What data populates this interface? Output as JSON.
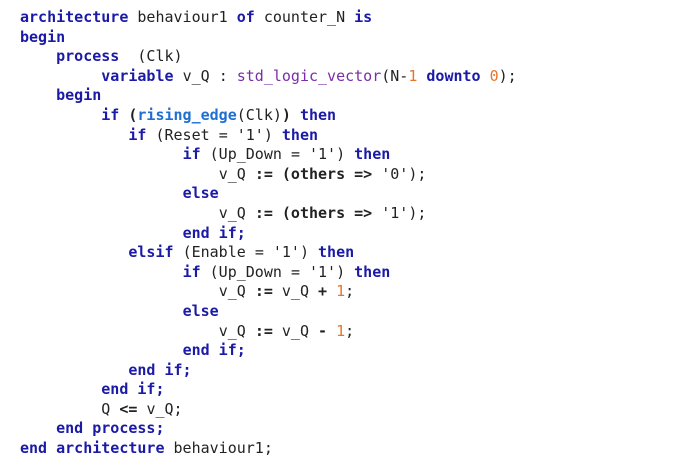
{
  "code": {
    "colors": {
      "keyword": "#1a1aa6",
      "type": "#7a2da8",
      "function": "#1f6fd1",
      "number": "#e8742a",
      "text": "#222222"
    },
    "lines": [
      [
        [
          "kw",
          "architecture"
        ],
        [
          "sp",
          " "
        ],
        [
          "id",
          "behaviour1"
        ],
        [
          "sp",
          " "
        ],
        [
          "kw",
          "of"
        ],
        [
          "sp",
          " "
        ],
        [
          "id",
          "counter_N"
        ],
        [
          "sp",
          " "
        ],
        [
          "kw",
          "is"
        ]
      ],
      [
        [
          "kw",
          "begin"
        ]
      ],
      [
        [
          "sp",
          "    "
        ],
        [
          "kw",
          "process"
        ],
        [
          "sp",
          "  "
        ],
        [
          "id",
          "(Clk)"
        ]
      ],
      [
        [
          "sp",
          "         "
        ],
        [
          "kw",
          "variable"
        ],
        [
          "sp",
          " "
        ],
        [
          "id",
          "v_Q"
        ],
        [
          "sp",
          " "
        ],
        [
          "id",
          ":"
        ],
        [
          "sp",
          " "
        ],
        [
          "type",
          "std_logic_vector"
        ],
        [
          "id",
          "(N-"
        ],
        [
          "num",
          "1"
        ],
        [
          "sp",
          " "
        ],
        [
          "kw",
          "downto"
        ],
        [
          "sp",
          " "
        ],
        [
          "num",
          "0"
        ],
        [
          "id",
          ");"
        ]
      ],
      [
        [
          "sp",
          "    "
        ],
        [
          "kw",
          "begin"
        ]
      ],
      [
        [
          "sp",
          "         "
        ],
        [
          "kw",
          "if"
        ],
        [
          "sp",
          " "
        ],
        [
          "op",
          "("
        ],
        [
          "fn",
          "rising_edge"
        ],
        [
          "id",
          "(Clk)"
        ],
        [
          "op",
          ")"
        ],
        [
          "sp",
          " "
        ],
        [
          "kw",
          "then"
        ]
      ],
      [
        [
          "sp",
          "            "
        ],
        [
          "kw",
          "if"
        ],
        [
          "sp",
          " "
        ],
        [
          "id",
          "(Reset"
        ],
        [
          "sp",
          " "
        ],
        [
          "id",
          "="
        ],
        [
          "sp",
          " "
        ],
        [
          "str",
          "'1')"
        ],
        [
          "sp",
          " "
        ],
        [
          "kw",
          "then"
        ]
      ],
      [
        [
          "sp",
          "                  "
        ],
        [
          "kw",
          "if"
        ],
        [
          "sp",
          " "
        ],
        [
          "id",
          "(Up_Down"
        ],
        [
          "sp",
          " "
        ],
        [
          "id",
          "="
        ],
        [
          "sp",
          " "
        ],
        [
          "str",
          "'1')"
        ],
        [
          "sp",
          " "
        ],
        [
          "kw",
          "then"
        ]
      ],
      [
        [
          "sp",
          "                      "
        ],
        [
          "id",
          "v_Q"
        ],
        [
          "sp",
          " "
        ],
        [
          "op",
          ":="
        ],
        [
          "sp",
          " "
        ],
        [
          "op",
          "(others"
        ],
        [
          "sp",
          " "
        ],
        [
          "op",
          "=>"
        ],
        [
          "sp",
          " "
        ],
        [
          "str",
          "'0');"
        ]
      ],
      [
        [
          "sp",
          "                  "
        ],
        [
          "kw",
          "else"
        ]
      ],
      [
        [
          "sp",
          "                      "
        ],
        [
          "id",
          "v_Q"
        ],
        [
          "sp",
          " "
        ],
        [
          "op",
          ":="
        ],
        [
          "sp",
          " "
        ],
        [
          "op",
          "(others"
        ],
        [
          "sp",
          " "
        ],
        [
          "op",
          "=>"
        ],
        [
          "sp",
          " "
        ],
        [
          "str",
          "'1');"
        ]
      ],
      [
        [
          "sp",
          "                  "
        ],
        [
          "kw",
          "end if;"
        ]
      ],
      [
        [
          "sp",
          "            "
        ],
        [
          "kw",
          "elsif"
        ],
        [
          "sp",
          " "
        ],
        [
          "id",
          "(Enable"
        ],
        [
          "sp",
          " "
        ],
        [
          "id",
          "="
        ],
        [
          "sp",
          " "
        ],
        [
          "str",
          "'1')"
        ],
        [
          "sp",
          " "
        ],
        [
          "kw",
          "then"
        ]
      ],
      [
        [
          "sp",
          "                  "
        ],
        [
          "kw",
          "if"
        ],
        [
          "sp",
          " "
        ],
        [
          "id",
          "(Up_Down"
        ],
        [
          "sp",
          " "
        ],
        [
          "id",
          "="
        ],
        [
          "sp",
          " "
        ],
        [
          "str",
          "'1')"
        ],
        [
          "sp",
          " "
        ],
        [
          "kw",
          "then"
        ]
      ],
      [
        [
          "sp",
          "                      "
        ],
        [
          "id",
          "v_Q"
        ],
        [
          "sp",
          " "
        ],
        [
          "op",
          ":="
        ],
        [
          "sp",
          " "
        ],
        [
          "id",
          "v_Q"
        ],
        [
          "sp",
          " "
        ],
        [
          "op",
          "+"
        ],
        [
          "sp",
          " "
        ],
        [
          "num",
          "1"
        ],
        [
          "id",
          ";"
        ]
      ],
      [
        [
          "sp",
          "                  "
        ],
        [
          "kw",
          "else"
        ]
      ],
      [
        [
          "sp",
          "                      "
        ],
        [
          "id",
          "v_Q"
        ],
        [
          "sp",
          " "
        ],
        [
          "op",
          ":="
        ],
        [
          "sp",
          " "
        ],
        [
          "id",
          "v_Q"
        ],
        [
          "sp",
          " "
        ],
        [
          "op",
          "-"
        ],
        [
          "sp",
          " "
        ],
        [
          "num",
          "1"
        ],
        [
          "id",
          ";"
        ]
      ],
      [
        [
          "sp",
          "                  "
        ],
        [
          "kw",
          "end if;"
        ]
      ],
      [
        [
          "sp",
          "            "
        ],
        [
          "kw",
          "end if;"
        ]
      ],
      [
        [
          "sp",
          "         "
        ],
        [
          "kw",
          "end if;"
        ]
      ],
      [
        [
          "sp",
          "         "
        ],
        [
          "id",
          "Q"
        ],
        [
          "sp",
          " "
        ],
        [
          "op",
          "<="
        ],
        [
          "sp",
          " "
        ],
        [
          "id",
          "v_Q;"
        ]
      ],
      [
        [
          "sp",
          "    "
        ],
        [
          "kw",
          "end process;"
        ]
      ],
      [
        [
          "kw",
          "end"
        ],
        [
          "sp",
          " "
        ],
        [
          "kw",
          "architecture"
        ],
        [
          "sp",
          " "
        ],
        [
          "id",
          "behaviour1;"
        ]
      ]
    ]
  }
}
